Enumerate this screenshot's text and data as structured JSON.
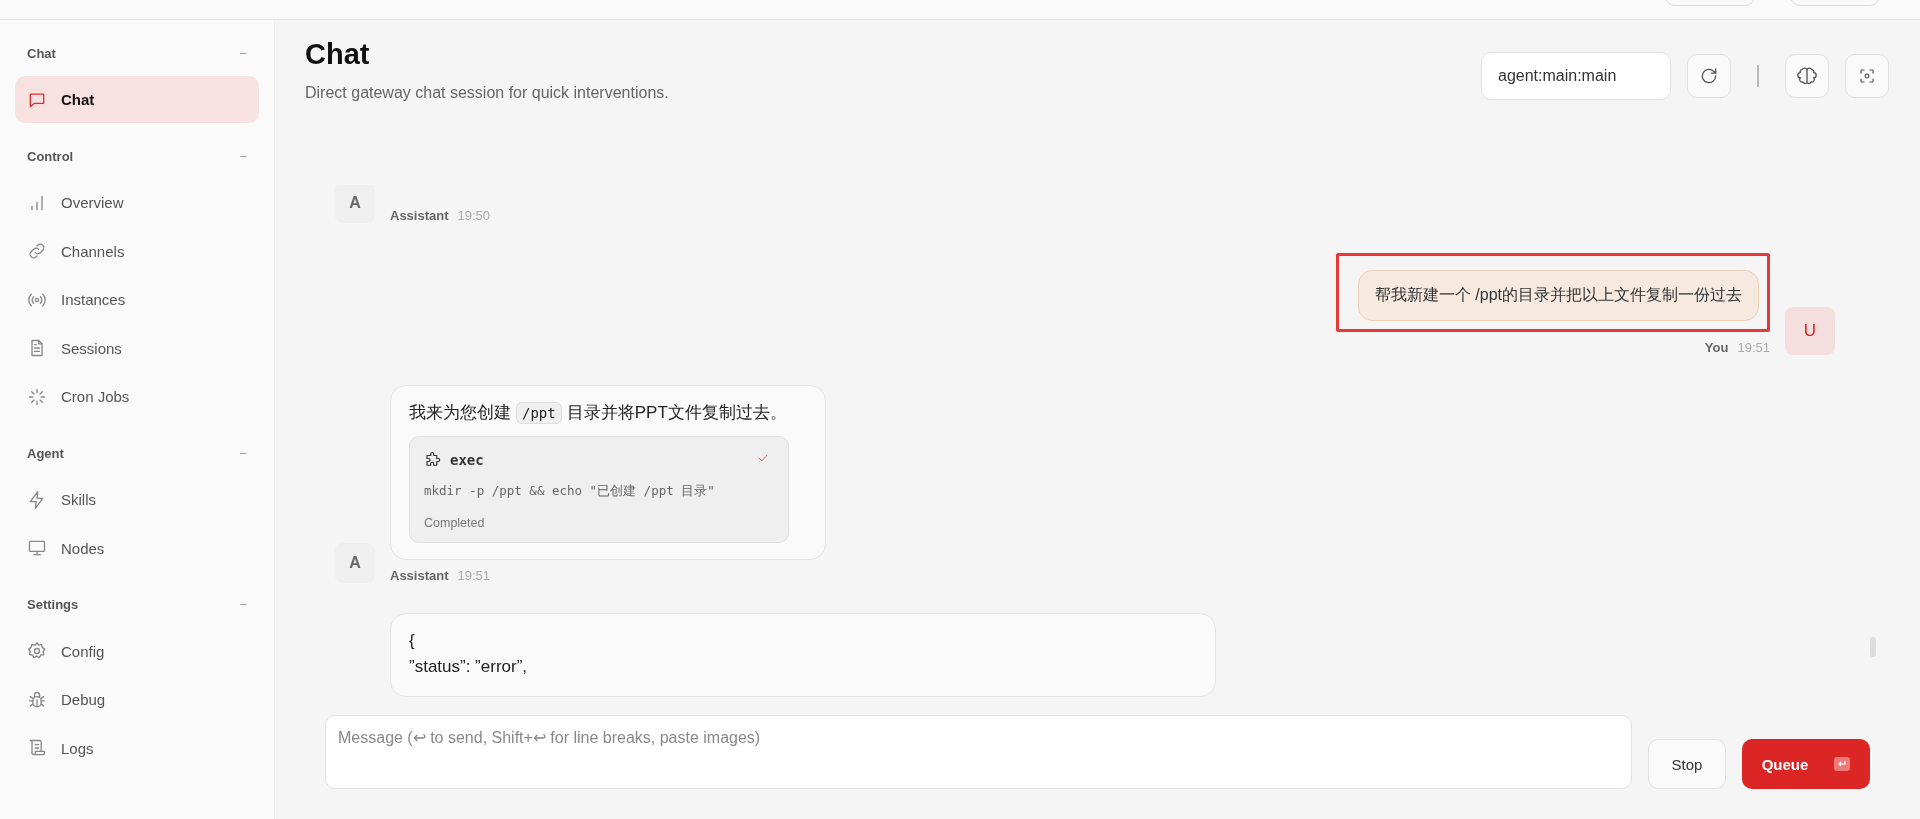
{
  "sidebar": {
    "sections": [
      {
        "title": "Chat",
        "collapse": "−",
        "items": [
          {
            "label": "Chat",
            "selected": true
          }
        ]
      },
      {
        "title": "Control",
        "collapse": "−",
        "items": [
          {
            "label": "Overview",
            "selected": false
          },
          {
            "label": "Channels",
            "selected": false
          },
          {
            "label": "Instances",
            "selected": false
          },
          {
            "label": "Sessions",
            "selected": false
          },
          {
            "label": "Cron Jobs",
            "selected": false
          }
        ]
      },
      {
        "title": "Agent",
        "collapse": "−",
        "items": [
          {
            "label": "Skills",
            "selected": false
          },
          {
            "label": "Nodes",
            "selected": false
          }
        ]
      },
      {
        "title": "Settings",
        "collapse": "−",
        "items": [
          {
            "label": "Config",
            "selected": false
          },
          {
            "label": "Debug",
            "selected": false
          },
          {
            "label": "Logs",
            "selected": false
          }
        ]
      }
    ]
  },
  "header": {
    "title": "Chat",
    "subtitle": "Direct gateway chat session for quick interventions.",
    "session": "agent:main:main"
  },
  "messages": [
    {
      "kind": "assistant",
      "avatar": "A",
      "sender": "Assistant",
      "time": "19:50"
    },
    {
      "kind": "user",
      "avatar": "U",
      "sender": "You",
      "time": "19:51",
      "highlighted": true,
      "text": "帮我新建一个 /ppt的目录并把以上文件复制一份过去"
    },
    {
      "kind": "assistant",
      "avatar": "A",
      "sender": "Assistant",
      "time": "19:51",
      "segments": [
        {
          "kind": "text",
          "text": "我来为您创建"
        },
        {
          "kind": "code",
          "text": "/ppt"
        },
        {
          "kind": "text",
          "text": "目录并将PPT文件复制过去。"
        }
      ],
      "tool": {
        "name": "exec",
        "done": true,
        "command": "mkdir -p /ppt && echo \"已创建 /ppt 目录\"",
        "status": "Completed"
      }
    },
    {
      "kind": "assistant",
      "lines": [
        "{",
        "”status”: ”error”,"
      ]
    }
  ],
  "composer": {
    "placeholder": "Message (↩ to send, Shift+↩ for line breaks, paste images)",
    "stop": "Stop",
    "queue": "Queue"
  }
}
